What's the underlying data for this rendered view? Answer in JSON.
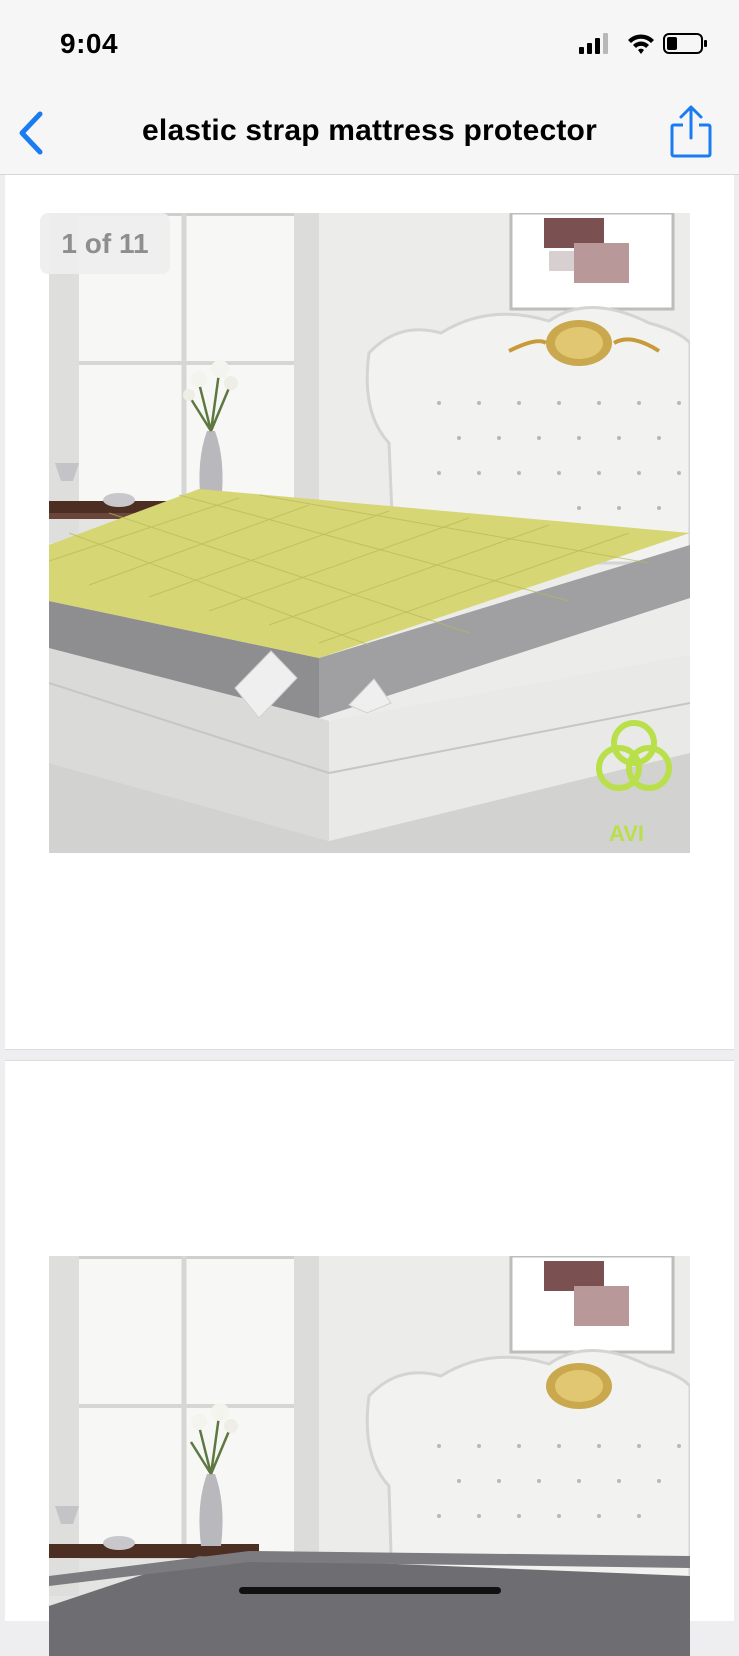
{
  "status_bar": {
    "time": "9:04"
  },
  "nav": {
    "title": "elastic strap mattress protector"
  },
  "gallery": {
    "counter": "1 of 11",
    "images": [
      {
        "alt": "elastic strap mattress protector",
        "color": "#d6d674",
        "brand": "AVI"
      },
      {
        "alt": "elastic strap mattress protector",
        "color": "#6e6e72"
      }
    ]
  },
  "colors": {
    "accent": "#1a7cf0"
  }
}
